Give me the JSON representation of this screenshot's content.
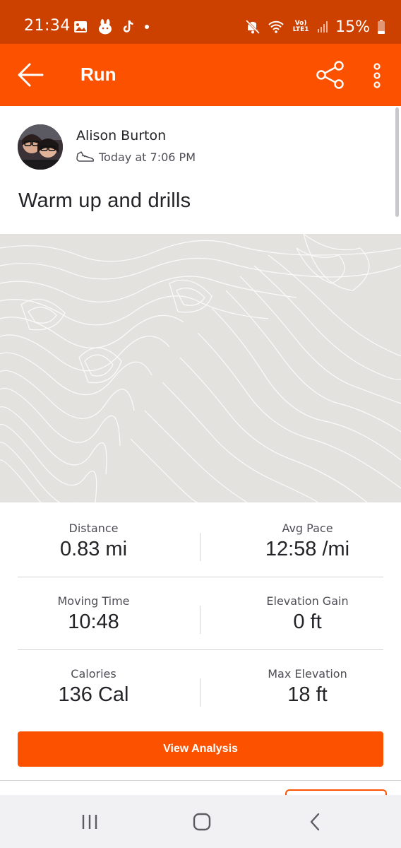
{
  "status_bar": {
    "time": "21:34",
    "battery": "15%",
    "left_icons": [
      "gallery-icon",
      "bunny-icon",
      "tiktok-icon",
      "dot-icon"
    ],
    "right_icons": [
      "mute-icon",
      "wifi-icon",
      "lte-icon",
      "signal-icon",
      "battery-icon"
    ],
    "lte_label": "Vo) LTE1"
  },
  "app_bar": {
    "title": "Run",
    "color": "#fc5200"
  },
  "athlete": {
    "name": "Alison Burton",
    "timestamp": "Today at 7:06 PM",
    "activity_icon": "shoe-icon"
  },
  "activity": {
    "title": "Warm up and drills"
  },
  "stats": [
    {
      "label": "Distance",
      "value": "0.83 mi"
    },
    {
      "label": "Avg Pace",
      "value": "12:58 /mi"
    },
    {
      "label": "Moving Time",
      "value": "10:48"
    },
    {
      "label": "Elevation Gain",
      "value": "0 ft"
    },
    {
      "label": "Calories",
      "value": "136 Cal"
    },
    {
      "label": "Max Elevation",
      "value": "18 ft"
    }
  ],
  "actions": {
    "view_analysis": "View Analysis"
  },
  "nav": {
    "recents": "recents-icon",
    "home": "home-icon",
    "back": "back-icon"
  }
}
